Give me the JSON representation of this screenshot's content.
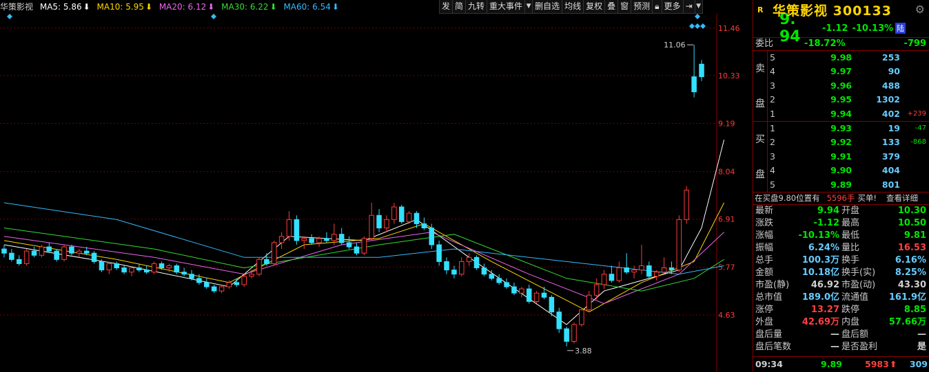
{
  "ma_bar": {
    "name": "华策影视",
    "ma5": "MA5: 5.86",
    "ma10": "MA10: 5.95",
    "ma20": "MA20: 6.12",
    "ma30": "MA30: 6.22",
    "ma60": "MA60: 6.54",
    "colors": {
      "name": "#d0d0d0",
      "ma5": "#ffffff",
      "ma10": "#ffd700",
      "ma20": "#ee66ee",
      "ma30": "#33dd33",
      "ma60": "#33bbff"
    }
  },
  "toolbar": [
    "发",
    "简",
    "九转",
    "重大事件",
    "删自选",
    "均线",
    "复权",
    "叠",
    "窗",
    "预测"
  ],
  "toolbar_more": "更多",
  "chart_data": {
    "type": "candlestick",
    "title": "",
    "y_ticks": [
      "11.46",
      "10.33",
      "9.19",
      "8.04",
      "6.91",
      "5.77",
      "4.63"
    ],
    "y_tick_values": [
      11.46,
      10.33,
      9.19,
      8.04,
      6.91,
      5.77,
      4.63
    ],
    "ylim": [
      3.5,
      11.8
    ],
    "annotations": {
      "high": "11.06",
      "low": "3.88",
      "high_value": 11.06,
      "low_value": 3.88
    },
    "colors": {
      "up": "#ff3b3b",
      "down": "#33e0ff",
      "grid": "#7a0000",
      "axis_text": "#ff3b3b"
    },
    "candles": [
      [
        6.2,
        6.3,
        6.0,
        6.1
      ],
      [
        6.1,
        6.2,
        5.9,
        5.95
      ],
      [
        5.95,
        6.05,
        5.8,
        5.85
      ],
      [
        5.85,
        6.2,
        5.8,
        6.15
      ],
      [
        6.15,
        6.25,
        6.0,
        6.05
      ],
      [
        6.05,
        6.3,
        6.0,
        6.25
      ],
      [
        6.25,
        6.35,
        6.1,
        6.15
      ],
      [
        6.15,
        6.2,
        5.9,
        5.95
      ],
      [
        5.95,
        6.3,
        5.9,
        6.25
      ],
      [
        6.25,
        6.3,
        6.05,
        6.1
      ],
      [
        6.1,
        6.2,
        6.0,
        6.15
      ],
      [
        6.15,
        6.25,
        6.05,
        6.1
      ],
      [
        6.1,
        6.15,
        5.85,
        5.9
      ],
      [
        5.9,
        5.95,
        5.65,
        5.7
      ],
      [
        5.7,
        5.9,
        5.6,
        5.85
      ],
      [
        5.85,
        5.9,
        5.7,
        5.75
      ],
      [
        5.75,
        5.8,
        5.6,
        5.65
      ],
      [
        5.65,
        5.8,
        5.55,
        5.75
      ],
      [
        5.75,
        5.85,
        5.65,
        5.7
      ],
      [
        5.7,
        5.8,
        5.6,
        5.65
      ],
      [
        5.65,
        5.9,
        5.6,
        5.85
      ],
      [
        5.85,
        5.9,
        5.7,
        5.75
      ],
      [
        5.75,
        5.85,
        5.65,
        5.8
      ],
      [
        5.8,
        5.85,
        5.6,
        5.65
      ],
      [
        5.65,
        5.75,
        5.55,
        5.6
      ],
      [
        5.6,
        5.7,
        5.45,
        5.5
      ],
      [
        5.5,
        5.6,
        5.35,
        5.4
      ],
      [
        5.4,
        5.5,
        5.25,
        5.3
      ],
      [
        5.3,
        5.35,
        5.15,
        5.2
      ],
      [
        5.2,
        5.35,
        5.15,
        5.3
      ],
      [
        5.3,
        5.45,
        5.25,
        5.4
      ],
      [
        5.4,
        5.5,
        5.3,
        5.35
      ],
      [
        5.35,
        5.6,
        5.3,
        5.55
      ],
      [
        5.55,
        5.7,
        5.5,
        5.6
      ],
      [
        5.6,
        6.0,
        5.55,
        5.95
      ],
      [
        5.95,
        6.1,
        5.8,
        5.85
      ],
      [
        5.85,
        6.4,
        5.8,
        6.35
      ],
      [
        6.35,
        6.6,
        6.2,
        6.5
      ],
      [
        6.5,
        7.1,
        6.4,
        6.9
      ],
      [
        6.9,
        7.0,
        6.3,
        6.4
      ],
      [
        6.4,
        6.5,
        6.2,
        6.45
      ],
      [
        6.45,
        6.55,
        6.3,
        6.35
      ],
      [
        6.35,
        6.5,
        6.25,
        6.45
      ],
      [
        6.45,
        6.6,
        6.35,
        6.4
      ],
      [
        6.4,
        6.8,
        6.3,
        6.55
      ],
      [
        6.55,
        6.7,
        6.3,
        6.35
      ],
      [
        6.35,
        6.5,
        6.2,
        6.25
      ],
      [
        6.25,
        6.35,
        6.05,
        6.1
      ],
      [
        6.1,
        6.5,
        6.05,
        6.45
      ],
      [
        6.45,
        7.3,
        6.4,
        7.0
      ],
      [
        7.0,
        7.15,
        6.6,
        6.7
      ],
      [
        6.7,
        7.0,
        6.6,
        6.9
      ],
      [
        6.9,
        7.3,
        6.8,
        7.2
      ],
      [
        7.2,
        7.25,
        6.8,
        6.85
      ],
      [
        6.85,
        7.1,
        6.8,
        7.05
      ],
      [
        7.05,
        7.1,
        6.7,
        6.8
      ],
      [
        6.8,
        6.95,
        6.65,
        6.7
      ],
      [
        6.7,
        6.8,
        6.2,
        6.3
      ],
      [
        6.3,
        6.4,
        5.8,
        5.9
      ],
      [
        5.9,
        6.0,
        5.6,
        5.7
      ],
      [
        5.7,
        5.8,
        5.5,
        5.6
      ],
      [
        5.6,
        6.0,
        5.55,
        5.9
      ],
      [
        5.9,
        6.1,
        5.8,
        6.0
      ],
      [
        6.0,
        6.05,
        5.7,
        5.75
      ],
      [
        5.75,
        5.85,
        5.55,
        5.6
      ],
      [
        5.6,
        5.7,
        5.45,
        5.5
      ],
      [
        5.5,
        5.6,
        5.35,
        5.4
      ],
      [
        5.4,
        5.5,
        5.25,
        5.3
      ],
      [
        5.3,
        5.4,
        5.1,
        5.15
      ],
      [
        5.15,
        5.3,
        5.05,
        5.25
      ],
      [
        5.25,
        5.35,
        4.9,
        4.95
      ],
      [
        4.95,
        5.2,
        4.9,
        5.15
      ],
      [
        5.15,
        5.3,
        5.0,
        5.05
      ],
      [
        5.05,
        5.1,
        4.6,
        4.7
      ],
      [
        4.7,
        4.8,
        4.2,
        4.3
      ],
      [
        4.3,
        4.35,
        3.88,
        4.0
      ],
      [
        4.0,
        4.45,
        3.95,
        4.4
      ],
      [
        4.4,
        4.8,
        4.35,
        4.75
      ],
      [
        4.75,
        5.2,
        4.7,
        5.1
      ],
      [
        5.1,
        5.5,
        5.0,
        5.35
      ],
      [
        5.35,
        5.7,
        5.25,
        5.6
      ],
      [
        5.6,
        5.8,
        5.4,
        5.45
      ],
      [
        5.45,
        5.9,
        5.4,
        5.75
      ],
      [
        5.75,
        6.1,
        5.6,
        5.65
      ],
      [
        5.65,
        5.8,
        5.5,
        5.7
      ],
      [
        5.7,
        6.3,
        5.6,
        5.8
      ],
      [
        5.8,
        5.9,
        5.5,
        5.55
      ],
      [
        5.55,
        5.7,
        5.45,
        5.65
      ],
      [
        5.65,
        6.0,
        5.6,
        5.75
      ],
      [
        5.75,
        5.9,
        5.6,
        5.7
      ],
      [
        5.7,
        7.0,
        5.65,
        6.9
      ],
      [
        6.9,
        7.7,
        6.8,
        7.6
      ],
      [
        10.3,
        11.06,
        9.81,
        9.94
      ],
      [
        10.6,
        10.7,
        10.2,
        10.3
      ]
    ],
    "ma_lines": {
      "ma5": [
        [
          0,
          6.3
        ],
        [
          15,
          5.85
        ],
        [
          30,
          5.3
        ],
        [
          38,
          6.5
        ],
        [
          48,
          6.4
        ],
        [
          55,
          6.9
        ],
        [
          62,
          6.0
        ],
        [
          75,
          4.4
        ],
        [
          80,
          5.2
        ],
        [
          90,
          5.7
        ],
        [
          93,
          6.7
        ],
        [
          96,
          8.8
        ]
      ],
      "ma10": [
        [
          0,
          6.4
        ],
        [
          15,
          5.95
        ],
        [
          30,
          5.4
        ],
        [
          40,
          6.3
        ],
        [
          50,
          6.45
        ],
        [
          56,
          6.8
        ],
        [
          65,
          5.9
        ],
        [
          78,
          4.7
        ],
        [
          85,
          5.4
        ],
        [
          92,
          5.9
        ],
        [
          96,
          7.3
        ]
      ],
      "ma20": [
        [
          0,
          6.5
        ],
        [
          20,
          6.0
        ],
        [
          32,
          5.6
        ],
        [
          45,
          6.3
        ],
        [
          57,
          6.6
        ],
        [
          70,
          5.6
        ],
        [
          80,
          4.9
        ],
        [
          90,
          5.6
        ],
        [
          96,
          6.6
        ]
      ],
      "ma30": [
        [
          0,
          6.7
        ],
        [
          20,
          6.2
        ],
        [
          32,
          5.75
        ],
        [
          50,
          6.3
        ],
        [
          60,
          6.55
        ],
        [
          75,
          5.5
        ],
        [
          85,
          5.2
        ],
        [
          92,
          5.5
        ],
        [
          96,
          5.95
        ]
      ],
      "ma60": [
        [
          0,
          7.3
        ],
        [
          15,
          6.9
        ],
        [
          32,
          6.0
        ],
        [
          50,
          6.0
        ],
        [
          60,
          6.2
        ],
        [
          75,
          5.9
        ],
        [
          90,
          5.6
        ],
        [
          96,
          5.8
        ]
      ]
    }
  },
  "panel": {
    "badge": "R",
    "name": "华策影视",
    "code": "300133",
    "last": "9. 94",
    "change": "-1.12",
    "pct": "-10.13%",
    "tag": "陆",
    "weibi_label": "委比",
    "weibi_pct": "-18.72%",
    "weibi_diff": "-799",
    "sell_label": "卖盘",
    "buy_label": "买盘",
    "sell": [
      {
        "lv": "5",
        "price": "9.98",
        "vol": "253",
        "diff": ""
      },
      {
        "lv": "4",
        "price": "9.97",
        "vol": "90",
        "diff": ""
      },
      {
        "lv": "3",
        "price": "9.96",
        "vol": "488",
        "diff": ""
      },
      {
        "lv": "2",
        "price": "9.95",
        "vol": "1302",
        "diff": ""
      },
      {
        "lv": "1",
        "price": "9.94",
        "vol": "402",
        "diff": "+239"
      }
    ],
    "buy": [
      {
        "lv": "1",
        "price": "9.93",
        "vol": "19",
        "diff": "-47"
      },
      {
        "lv": "2",
        "price": "9.92",
        "vol": "133",
        "diff": "-868"
      },
      {
        "lv": "3",
        "price": "9.91",
        "vol": "379",
        "diff": ""
      },
      {
        "lv": "4",
        "price": "9.90",
        "vol": "404",
        "diff": ""
      },
      {
        "lv": "5",
        "price": "9.89",
        "vol": "801",
        "diff": ""
      }
    ],
    "info": {
      "prefix": "在买盘9.80位置有",
      "qty": "5596手",
      "suffix": "买单!",
      "link": "查看详细"
    },
    "stats": [
      {
        "l1": "最新",
        "v1": "9.94",
        "c1": "g",
        "l2": "开盘",
        "v2": "10.30",
        "c2": "g"
      },
      {
        "l1": "涨跌",
        "v1": "-1.12",
        "c1": "g",
        "l2": "最高",
        "v2": "10.50",
        "c2": "g"
      },
      {
        "l1": "涨幅",
        "v1": "-10.13%",
        "c1": "g",
        "l2": "最低",
        "v2": "9.81",
        "c2": "g"
      },
      {
        "l1": "振幅",
        "v1": "6.24%",
        "c1": "c",
        "l2": "量比",
        "v2": "16.53",
        "c2": "rd"
      },
      {
        "l1": "总手",
        "v1": "100.3万",
        "c1": "c",
        "l2": "换手",
        "v2": "6.16%",
        "c2": "c"
      },
      {
        "l1": "金额",
        "v1": "10.18亿",
        "c1": "c",
        "l2": "换手(实)",
        "v2": "8.25%",
        "c2": "c"
      },
      {
        "l1": "市盈(静)",
        "v1": "46.92",
        "c1": "w",
        "l2": "市盈(动)",
        "v2": "43.30",
        "c2": "w"
      },
      {
        "l1": "总市值",
        "v1": "189.0亿",
        "c1": "c",
        "l2": "流通值",
        "v2": "161.9亿",
        "c2": "c"
      },
      {
        "l1": "涨停",
        "v1": "13.27",
        "c1": "rd",
        "l2": "跌停",
        "v2": "8.85",
        "c2": "g"
      },
      {
        "l1": "外盘",
        "v1": "42.69万",
        "c1": "rd",
        "l2": "内盘",
        "v2": "57.66万",
        "c2": "g"
      },
      {
        "l1": "盘后量",
        "v1": "—",
        "c1": "w",
        "l2": "盘后额",
        "v2": "—",
        "c2": "w"
      },
      {
        "l1": "盘后笔数",
        "v1": "—",
        "c1": "w",
        "l2": "是否盈利",
        "v2": "是",
        "c2": "w"
      }
    ],
    "tick": {
      "time": "09:34",
      "price": "9.89",
      "vol": "5983",
      "count": "309"
    }
  }
}
